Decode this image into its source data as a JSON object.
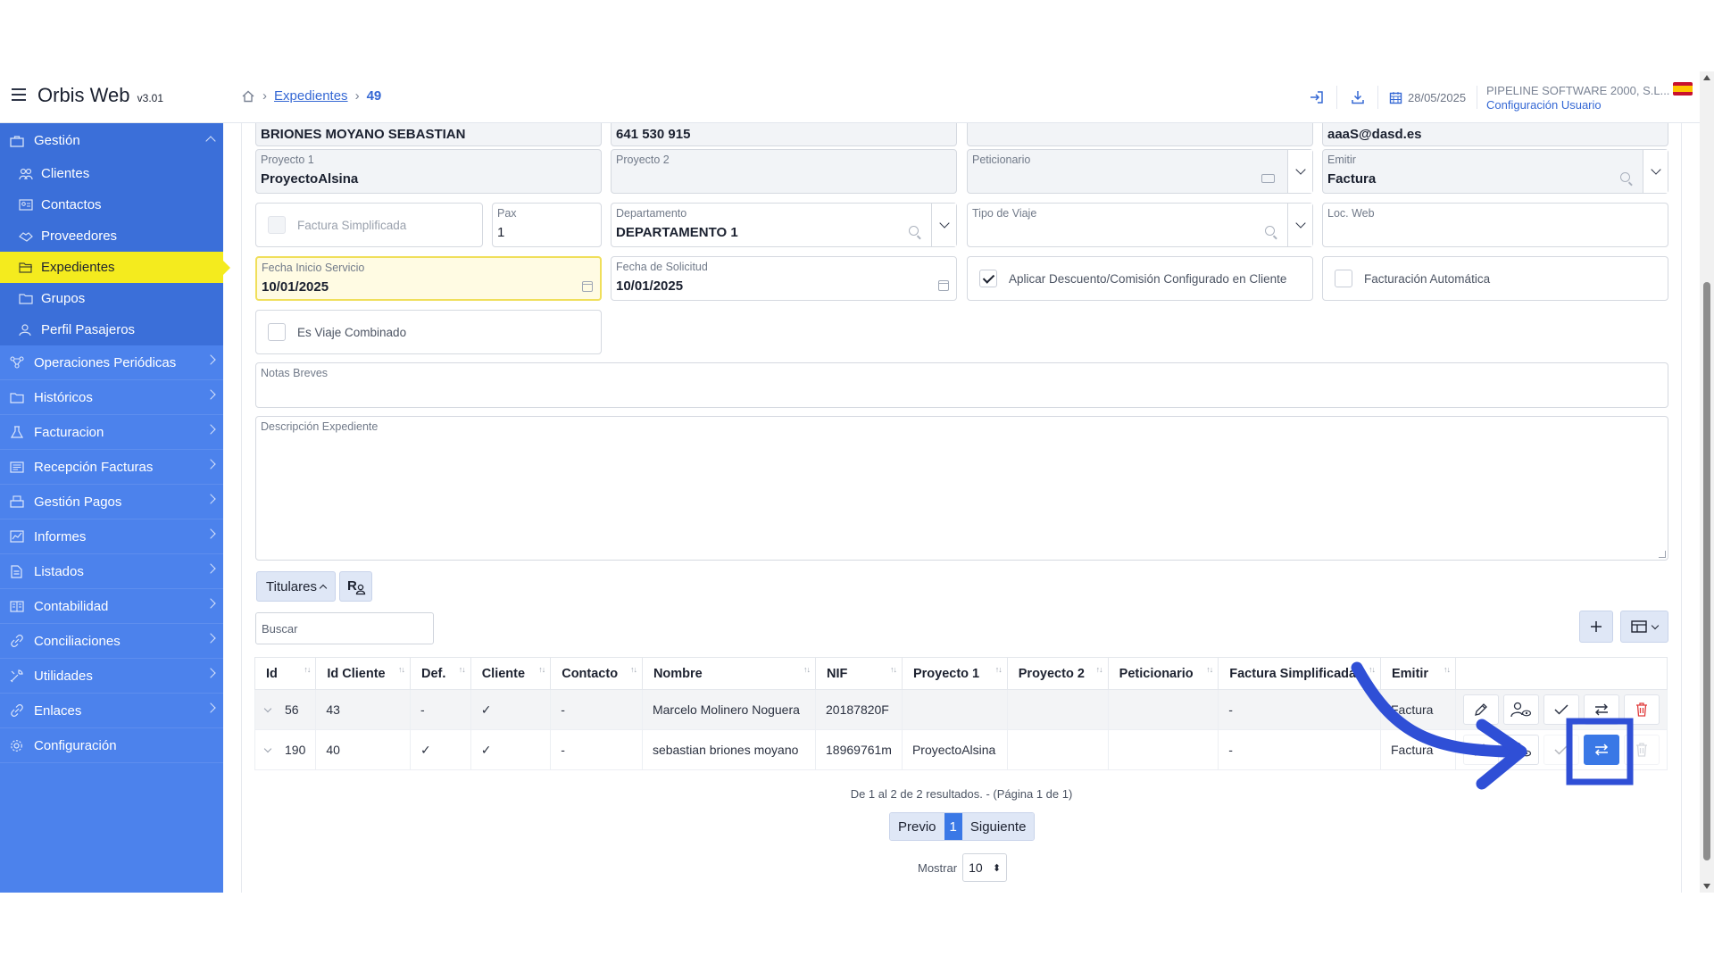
{
  "app": {
    "name": "Orbis Web",
    "version": "v3.01"
  },
  "breadcrumb": {
    "link": "Expedientes",
    "current": "49"
  },
  "header": {
    "date": "28/05/2025",
    "company": "PIPELINE SOFTWARE 2000, S.L...",
    "config_link": "Configuración Usuario"
  },
  "sidebar": {
    "group": "Gestión",
    "subitems": [
      "Clientes",
      "Contactos",
      "Proveedores",
      "Expedientes",
      "Grupos",
      "Perfil Pasajeros"
    ],
    "active": "Expedientes",
    "items": [
      "Operaciones Periódicas",
      "Históricos",
      "Facturacion",
      "Recepción Facturas",
      "Gestión Pagos",
      "Informes",
      "Listados",
      "Contabilidad",
      "Conciliaciones",
      "Utilidades",
      "Enlaces",
      "Configuración"
    ]
  },
  "form": {
    "top_row": {
      "name": "BRIONES MOYANO SEBASTIAN",
      "phone": "641 530 915",
      "empty": "",
      "email": "aaaS@dasd.es"
    },
    "proyecto1": {
      "label": "Proyecto 1",
      "value": "ProyectoAlsina"
    },
    "proyecto2": {
      "label": "Proyecto 2",
      "value": ""
    },
    "peticionario": {
      "label": "Peticionario",
      "value": ""
    },
    "emitir": {
      "label": "Emitir",
      "value": "Factura"
    },
    "factura_simplificada": {
      "label": "Factura Simplificada",
      "checked": false
    },
    "pax": {
      "label": "Pax",
      "value": "1"
    },
    "departamento": {
      "label": "Departamento",
      "value": "DEPARTAMENTO 1"
    },
    "tipo_viaje": {
      "label": "Tipo de Viaje",
      "value": ""
    },
    "loc_web": {
      "label": "Loc. Web",
      "value": ""
    },
    "fecha_inicio": {
      "label": "Fecha Inicio Servicio",
      "value": "10/01/2025"
    },
    "fecha_solicitud": {
      "label": "Fecha de Solicitud",
      "value": "10/01/2025"
    },
    "aplicar_descuento": {
      "label": "Aplicar Descuento/Comisión Configurado en Cliente",
      "checked": true
    },
    "facturacion_auto": {
      "label": "Facturación Automática",
      "checked": false
    },
    "viaje_combinado": {
      "label": "Es Viaje Combinado",
      "checked": false
    },
    "notas": {
      "label": "Notas Breves",
      "value": ""
    },
    "descripcion": {
      "label": "Descripción Expediente",
      "value": ""
    }
  },
  "titulares": {
    "tab_label": "Titulares",
    "search_placeholder": "Buscar",
    "columns": [
      "Id",
      "Id Cliente",
      "Def.",
      "Cliente",
      "Contacto",
      "Nombre",
      "NIF",
      "Proyecto 1",
      "Proyecto 2",
      "Peticionario",
      "Factura Simplificada",
      "Emitir"
    ],
    "rows": [
      [
        "56",
        "43",
        "-",
        "✓",
        "-",
        "Marcelo Molinero Noguera",
        "20187820F",
        "",
        "",
        "",
        "-",
        "Factura"
      ],
      [
        "190",
        "40",
        "✓",
        "✓",
        "-",
        "sebastian briones moyano",
        "18969761m",
        "ProyectoAlsina",
        "",
        "",
        "-",
        "Factura"
      ]
    ],
    "results_text": "De 1 al 2 de 2 resultados. - (Página 1 de 1)",
    "prev_label": "Previo",
    "current_page": "1",
    "next_label": "Siguiente",
    "show_label": "Mostrar",
    "page_size": "10"
  },
  "colors": {
    "sidebar": "#4c82ec",
    "active": "#f4eb1e",
    "primary": "#3a78e6",
    "annotation": "#2f4fd6"
  }
}
